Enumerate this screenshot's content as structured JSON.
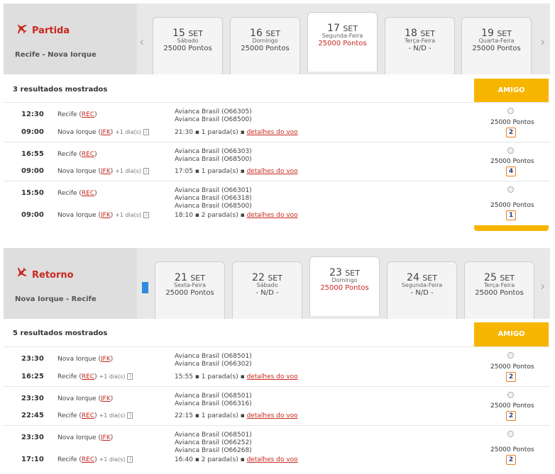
{
  "outbound": {
    "title": "Partida",
    "route": "Recife - Nova Iorque",
    "dates": [
      {
        "day": "15",
        "month": "SET",
        "weekday": "Sábado",
        "price": "25000 Pontos",
        "selected": false
      },
      {
        "day": "16",
        "month": "SET",
        "weekday": "Domingo",
        "price": "25000 Pontos",
        "selected": false
      },
      {
        "day": "17",
        "month": "SET",
        "weekday": "Segunda-Feira",
        "price": "25000 Pontos",
        "selected": true
      },
      {
        "day": "18",
        "month": "SET",
        "weekday": "Terça-Feira",
        "price": "- N/D -",
        "selected": false
      },
      {
        "day": "19",
        "month": "SET",
        "weekday": "Quarta-Feira",
        "price": "25000 Pontos",
        "selected": false
      }
    ],
    "results_count": "3 resultados mostrados",
    "fare_label": "AMIGO",
    "flights": [
      {
        "dep_time": "12:30",
        "dep_city": "Recife",
        "dep_code": "REC",
        "arr_time": "09:00",
        "arr_city": "Nova Iorque",
        "arr_code": "JFK",
        "plus_day": "+1 dia(s)",
        "segments": [
          "Avianca Brasil (O66305)",
          "Avianca Brasil (O68500)"
        ],
        "duration": "21:30",
        "stops": "1 parada(s)",
        "details": "detalhes do voo",
        "points": "25000 Pontos",
        "seats": "2"
      },
      {
        "dep_time": "16:55",
        "dep_city": "Recife",
        "dep_code": "REC",
        "arr_time": "09:00",
        "arr_city": "Nova Iorque",
        "arr_code": "JFK",
        "plus_day": "+1 dia(s)",
        "segments": [
          "Avianca Brasil (O66303)",
          "Avianca Brasil (O68500)"
        ],
        "duration": "17:05",
        "stops": "1 parada(s)",
        "details": "detalhes do voo",
        "points": "25000 Pontos",
        "seats": "4"
      },
      {
        "dep_time": "15:50",
        "dep_city": "Recife",
        "dep_code": "REC",
        "arr_time": "09:00",
        "arr_city": "Nova Iorque",
        "arr_code": "JFK",
        "plus_day": "+1 dia(s)",
        "segments": [
          "Avianca Brasil (O66301)",
          "Avianca Brasil (O66318)",
          "Avianca Brasil (O68500)"
        ],
        "duration": "18:10",
        "stops": "2 parada(s)",
        "details": "detalhes do voo",
        "points": "25000 Pontos",
        "seats": "1"
      }
    ]
  },
  "return": {
    "title": "Retorno",
    "route": "Nova Iorque - Recife",
    "dates": [
      {
        "day": "21",
        "month": "SET",
        "weekday": "Sexta-Feira",
        "price": "25000 Pontos",
        "selected": false
      },
      {
        "day": "22",
        "month": "SET",
        "weekday": "Sábado",
        "price": "- N/D -",
        "selected": false
      },
      {
        "day": "23",
        "month": "SET",
        "weekday": "Domingo",
        "price": "25000 Pontos",
        "selected": true
      },
      {
        "day": "24",
        "month": "SET",
        "weekday": "Segunda-Feira",
        "price": "- N/D -",
        "selected": false
      },
      {
        "day": "25",
        "month": "SET",
        "weekday": "Terça-Feira",
        "price": "25000 Pontos",
        "selected": false
      }
    ],
    "results_count": "5 resultados mostrados",
    "fare_label": "AMIGO",
    "flights": [
      {
        "dep_time": "23:30",
        "dep_city": "Nova Iorque",
        "dep_code": "JFK",
        "arr_time": "16:25",
        "arr_city": "Recife",
        "arr_code": "REC",
        "plus_day": "+1 dia(s)",
        "segments": [
          "Avianca Brasil (O68501)",
          "Avianca Brasil (O66302)"
        ],
        "duration": "15:55",
        "stops": "1 parada(s)",
        "details": "detalhes do voo",
        "points": "25000 Pontos",
        "seats": "2"
      },
      {
        "dep_time": "23:30",
        "dep_city": "Nova Iorque",
        "dep_code": "JFK",
        "arr_time": "22:45",
        "arr_city": "Recife",
        "arr_code": "REC",
        "plus_day": "+1 dia(s)",
        "segments": [
          "Avianca Brasil (O68501)",
          "Avianca Brasil (O66316)"
        ],
        "duration": "22:15",
        "stops": "1 parada(s)",
        "details": "detalhes do voo",
        "points": "25000 Pontos",
        "seats": "2"
      },
      {
        "dep_time": "23:30",
        "dep_city": "Nova Iorque",
        "dep_code": "JFK",
        "arr_time": "17:10",
        "arr_city": "Recife",
        "arr_code": "REC",
        "plus_day": "+1 dia(s)",
        "segments": [
          "Avianca Brasil (O68501)",
          "Avianca Brasil (O66252)",
          "Avianca Brasil (O66268)"
        ],
        "duration": "16:40",
        "stops": "2 parada(s)",
        "details": "detalhes do voo",
        "points": "25000 Pontos",
        "seats": "2"
      }
    ]
  },
  "icons": {
    "plane": "airplane-icon",
    "prev": "chevron-left-icon",
    "next": "chevron-right-icon",
    "info": "info-icon",
    "seat": "seat-count-icon"
  },
  "colors": {
    "accent": "#c8281e",
    "fare": "#f7b500"
  }
}
